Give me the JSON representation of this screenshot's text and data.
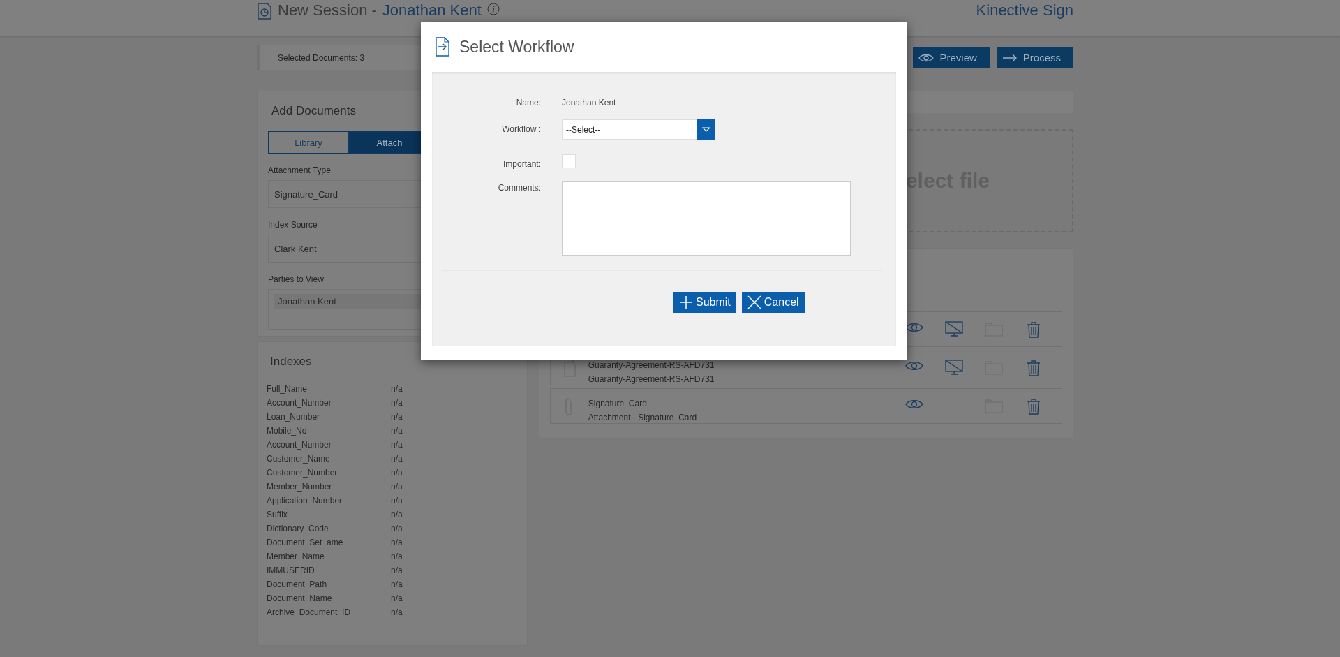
{
  "header": {
    "title": "New Session -",
    "client": "Jonathan Kent",
    "brand": "Kinective Sign"
  },
  "toolbar": {
    "selected_documents": "Selected Documents: 3",
    "buttons": [
      {
        "label": "Preview",
        "kind": "preview"
      },
      {
        "label": "Process",
        "kind": "process"
      }
    ]
  },
  "add_documents": {
    "title": "Add Documents",
    "tabs": [
      {
        "label": "Library",
        "selected": false
      },
      {
        "label": "Attach",
        "selected": true
      }
    ],
    "fields": [
      {
        "label": "Attachment Type",
        "value": "Signature_Card"
      },
      {
        "label": "Index Source",
        "value": "Clark Kent"
      }
    ],
    "parties": {
      "label": "Parties to View",
      "items": [
        "Jonathan Kent"
      ]
    }
  },
  "indexes": {
    "title": "Indexes",
    "rows": [
      {
        "name": "Full_Name",
        "value": "n/a"
      },
      {
        "name": "Account_Number",
        "value": "n/a"
      },
      {
        "name": "Loan_Number",
        "value": "n/a"
      },
      {
        "name": "Mobile_No",
        "value": "n/a"
      },
      {
        "name": "Account_Number",
        "value": "n/a"
      },
      {
        "name": "Customer_Name",
        "value": "n/a"
      },
      {
        "name": "Customer_Number",
        "value": "n/a"
      },
      {
        "name": "Member_Number",
        "value": "n/a"
      },
      {
        "name": "Application_Number",
        "value": "n/a"
      },
      {
        "name": "Suffix",
        "value": "n/a"
      },
      {
        "name": "Dictionary_Code",
        "value": "n/a"
      },
      {
        "name": "Document_Set_ame",
        "value": "n/a"
      },
      {
        "name": "Member_Name",
        "value": "n/a"
      },
      {
        "name": "IMMUSERID",
        "value": "n/a"
      },
      {
        "name": "Document_Path",
        "value": "n/a"
      },
      {
        "name": "Document_Name",
        "value": "n/a"
      },
      {
        "name": "Archive_Document_ID",
        "value": "n/a"
      }
    ]
  },
  "upload": {
    "prompt": "elect file"
  },
  "documents": [
    {
      "actions": [
        {
          "kind": "view"
        },
        {
          "kind": "screen"
        },
        {
          "kind": "folder"
        },
        {
          "kind": "delete"
        }
      ]
    },
    {
      "kind": "document",
      "name": "Guaranty-Agreement-RS-AFD731",
      "description": "Guaranty-Agreement-RS-AFD731",
      "actions": [
        {
          "kind": "view"
        },
        {
          "kind": "screen"
        },
        {
          "kind": "folder"
        },
        {
          "kind": "delete"
        }
      ]
    },
    {
      "kind": "attachment",
      "name": "Signature_Card",
      "description": "Attachment - Signature_Card",
      "actions": [
        {
          "kind": "view"
        },
        {
          "kind": "folder"
        },
        {
          "kind": "delete"
        }
      ]
    }
  ],
  "dialog": {
    "title": "Select Workflow",
    "fields": [
      {
        "kind": "text",
        "label": "Name:",
        "value": "Jonathan Kent"
      },
      {
        "kind": "select",
        "label": "Workflow :",
        "value": "--Select--"
      },
      {
        "kind": "checkbox",
        "label": "Important:",
        "checked": false
      },
      {
        "kind": "textarea",
        "label": "Comments:"
      }
    ],
    "buttons": [
      {
        "label": "Submit",
        "kind": "submit"
      },
      {
        "label": "Cancel",
        "kind": "cancel"
      }
    ]
  }
}
